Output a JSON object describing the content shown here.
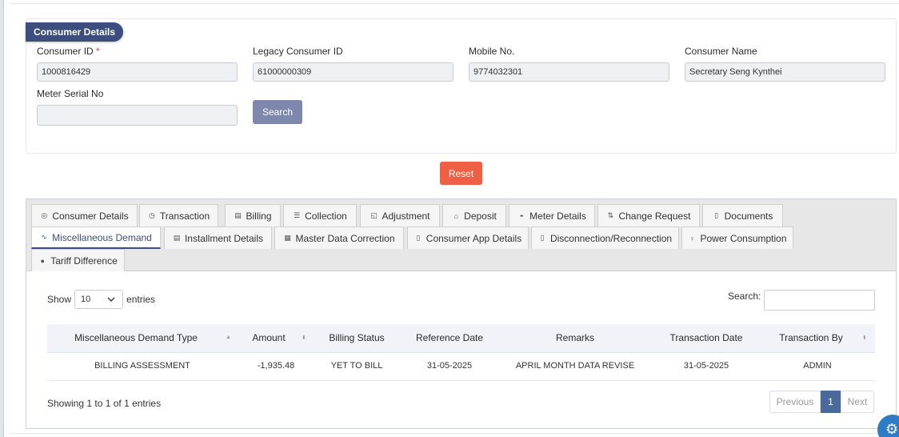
{
  "consumer_card": {
    "title": "Consumer Details",
    "consumer_id": {
      "label": "Consumer ID",
      "required_mark": "*",
      "value": "1000816429"
    },
    "legacy_consumer_id": {
      "label": "Legacy Consumer ID",
      "value": "61000000309"
    },
    "mobile_no": {
      "label": "Mobile No.",
      "value": "9774032301"
    },
    "consumer_name": {
      "label": "Consumer Name",
      "value": "Secretary  Seng Kynthei"
    },
    "meter_serial_no": {
      "label": "Meter Serial No",
      "value": ""
    },
    "search_button": "Search"
  },
  "reset_button": "Reset",
  "tabs": [
    {
      "label": "Consumer Details",
      "icon": "circle-icon",
      "glyph": "◎"
    },
    {
      "label": "Transaction",
      "icon": "clock-icon",
      "glyph": "◷"
    },
    {
      "label": "Billing",
      "icon": "bill-icon",
      "glyph": "▤"
    },
    {
      "label": "Collection",
      "icon": "list-icon",
      "glyph": "☰"
    },
    {
      "label": "Adjustment",
      "icon": "adjust-icon",
      "glyph": "◱"
    },
    {
      "label": "Deposit",
      "icon": "bank-icon",
      "glyph": "⌂"
    },
    {
      "label": "Meter Details",
      "icon": "gauge-icon",
      "glyph": "◓"
    },
    {
      "label": "Change Request",
      "icon": "swap-icon",
      "glyph": "⇅"
    },
    {
      "label": "Documents",
      "icon": "document-icon",
      "glyph": "▯"
    },
    {
      "label": "Miscellaneous Demand",
      "icon": "chart-line-icon",
      "glyph": "∿",
      "active": true
    },
    {
      "label": "Installment Details",
      "icon": "receipt-icon",
      "glyph": "▤"
    },
    {
      "label": "Master Data Correction",
      "icon": "table-icon",
      "glyph": "▦"
    },
    {
      "label": "Consumer App Details",
      "icon": "mobile-icon",
      "glyph": "▯"
    },
    {
      "label": "Disconnection/Reconnection",
      "icon": "plug-icon",
      "glyph": "▯"
    },
    {
      "label": "Power Consumption",
      "icon": "bulb-icon",
      "glyph": "♀"
    },
    {
      "label": "Tariff Difference",
      "icon": "dot-icon",
      "glyph": "●"
    }
  ],
  "table_controls": {
    "show_label": "Show",
    "entries_value": "10",
    "entries_label": "entries",
    "search_label": "Search:",
    "search_value": ""
  },
  "table": {
    "headers": [
      "Miscellaneous Demand Type",
      "Amount",
      "Billing Status",
      "Reference Date",
      "Remarks",
      "Transaction Date",
      "Transaction By"
    ],
    "rows": [
      [
        "BILLING ASSESSMENT",
        "-1,935.48",
        "YET TO BILL",
        "31-05-2025",
        "APRIL MONTH DATA REVISE",
        "31-05-2025",
        "ADMIN"
      ]
    ]
  },
  "table_info": "Showing 1 to 1 of 1 entries",
  "pagination": {
    "previous": "Previous",
    "current": "1",
    "next": "Next"
  },
  "colors": {
    "primary": "#3c4d7e",
    "reset": "#ef5f43",
    "search_button": "#7e88ad",
    "page_active": "#4a6a9c",
    "gear": "#2e7bc6"
  }
}
